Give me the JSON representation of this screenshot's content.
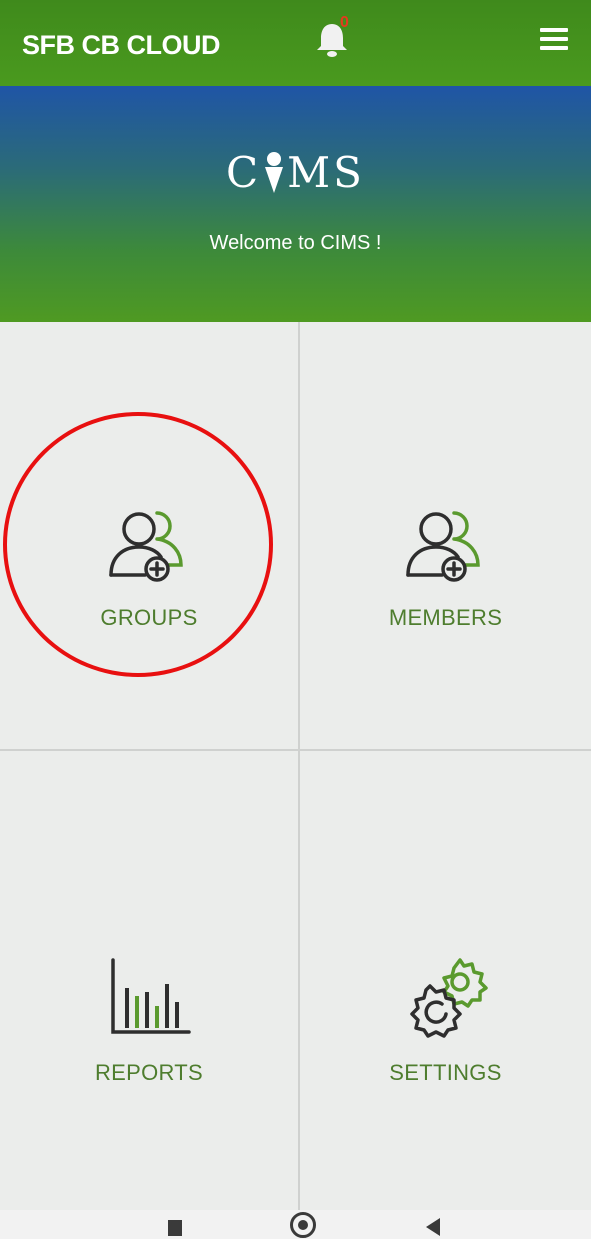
{
  "header": {
    "title": "SFB CB CLOUD",
    "notification_count": "0",
    "bell_icon": "bell-icon",
    "menu_icon": "hamburger-menu-icon"
  },
  "banner": {
    "logo_text_left": "C",
    "logo_text_right": "MS",
    "welcome": "Welcome to CIMS !"
  },
  "tiles": [
    {
      "label": "GROUPS",
      "icon": "add-group-icon"
    },
    {
      "label": "MEMBERS",
      "icon": "add-member-icon"
    },
    {
      "label": "REPORTS",
      "icon": "bar-chart-icon"
    },
    {
      "label": "SETTINGS",
      "icon": "gears-icon"
    }
  ],
  "colors": {
    "header_green": "#4a9a1e",
    "banner_blue": "#1f55a6",
    "accent_green": "#4e7d2e",
    "annotation_red": "#e81010"
  },
  "navbar": {
    "icons": [
      "recents-icon",
      "home-icon",
      "back-icon"
    ]
  }
}
